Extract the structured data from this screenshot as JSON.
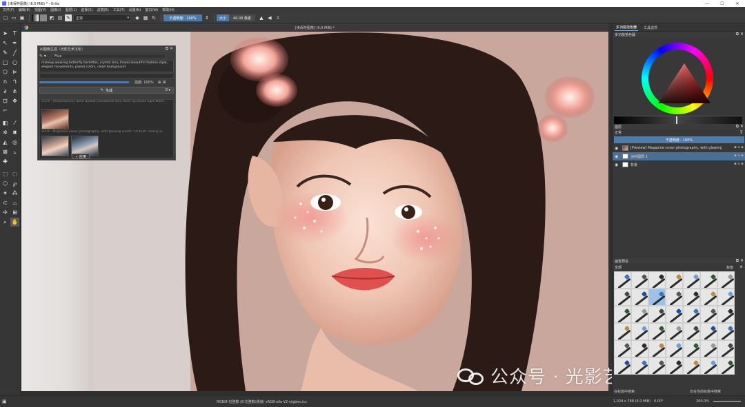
{
  "window": {
    "title": "[未保存图像] (6.0 MiB) * - Krita",
    "controls": [
      "—",
      "☐",
      "✕"
    ]
  },
  "menu": {
    "items": [
      "文件(F)",
      "编辑(E)",
      "视图(V)",
      "图像(I)",
      "图层(L)",
      "选择(S)",
      "滤镜(R)",
      "工具(T)",
      "设置(N)",
      "窗口(W)",
      "帮助(H)"
    ]
  },
  "tool_options": {
    "blend_mode": "正常",
    "opacity_label": "不透明度：100%",
    "size_label": "大小",
    "size_value": "40.00 像素"
  },
  "canvas": {
    "tab_title": "[未保存图像] (6.0 MiB) *"
  },
  "ai_panel": {
    "title": "AI图像生成（光影艺术汉化）",
    "model": "Flux",
    "prompt": "makeup,wearing butterfly barrettes, crystal lace, Kawaii beautiful fashion style, elegant movements, pastel colors, clean background",
    "strength_label": "强度: 100%",
    "generate_label": "生成",
    "history_1": "3/2/4 - (masterpiece) (best quality),emotional lens close-up,studio light,Make...",
    "history_2": "3/2/4 - Magazine cover photography, with glowing words \"OTREM\" clearly w...",
    "apply_label": "✓ 应用",
    "count": "0 ▾"
  },
  "dock": {
    "tabs": [
      "多功能拾色器",
      "工具选项"
    ],
    "active_tab": "多功能拾色器",
    "color_selector_title": "多功能拾色器",
    "layers_title": "图层",
    "layer_blend": "正常",
    "layer_opacity": "不透明度：100%",
    "layers": [
      {
        "name": "[Preview] Magazine cover photography, with glowing w...",
        "selected": false,
        "thumb": "img"
      },
      {
        "name": "涂料图层 1",
        "selected": true,
        "thumb": "white"
      },
      {
        "name": "背景",
        "selected": false,
        "thumb": "white"
      }
    ],
    "presets_title": "画笔预设",
    "presets_filter": "全部",
    "presets_tag_label": "标签",
    "presets_search_placeholder": "在标签中搜索",
    "presets_option": "仅在当前标签中搜索"
  },
  "status": {
    "color_info": "RGB/8-位整数 (8 位整数/通道)   sRGB-elle-V2-srgbtrc.icc",
    "doc_info": "1,024 x 768 (6.0 MiB)",
    "rotation": "0.00°",
    "zoom": "200.0%"
  },
  "watermark": {
    "text": "公众号 · 光影艺术汉化馆"
  },
  "colors": {
    "accent": "#4f7ba8",
    "selected_layer": "#4a6f96",
    "panel_bg": "#383838"
  }
}
